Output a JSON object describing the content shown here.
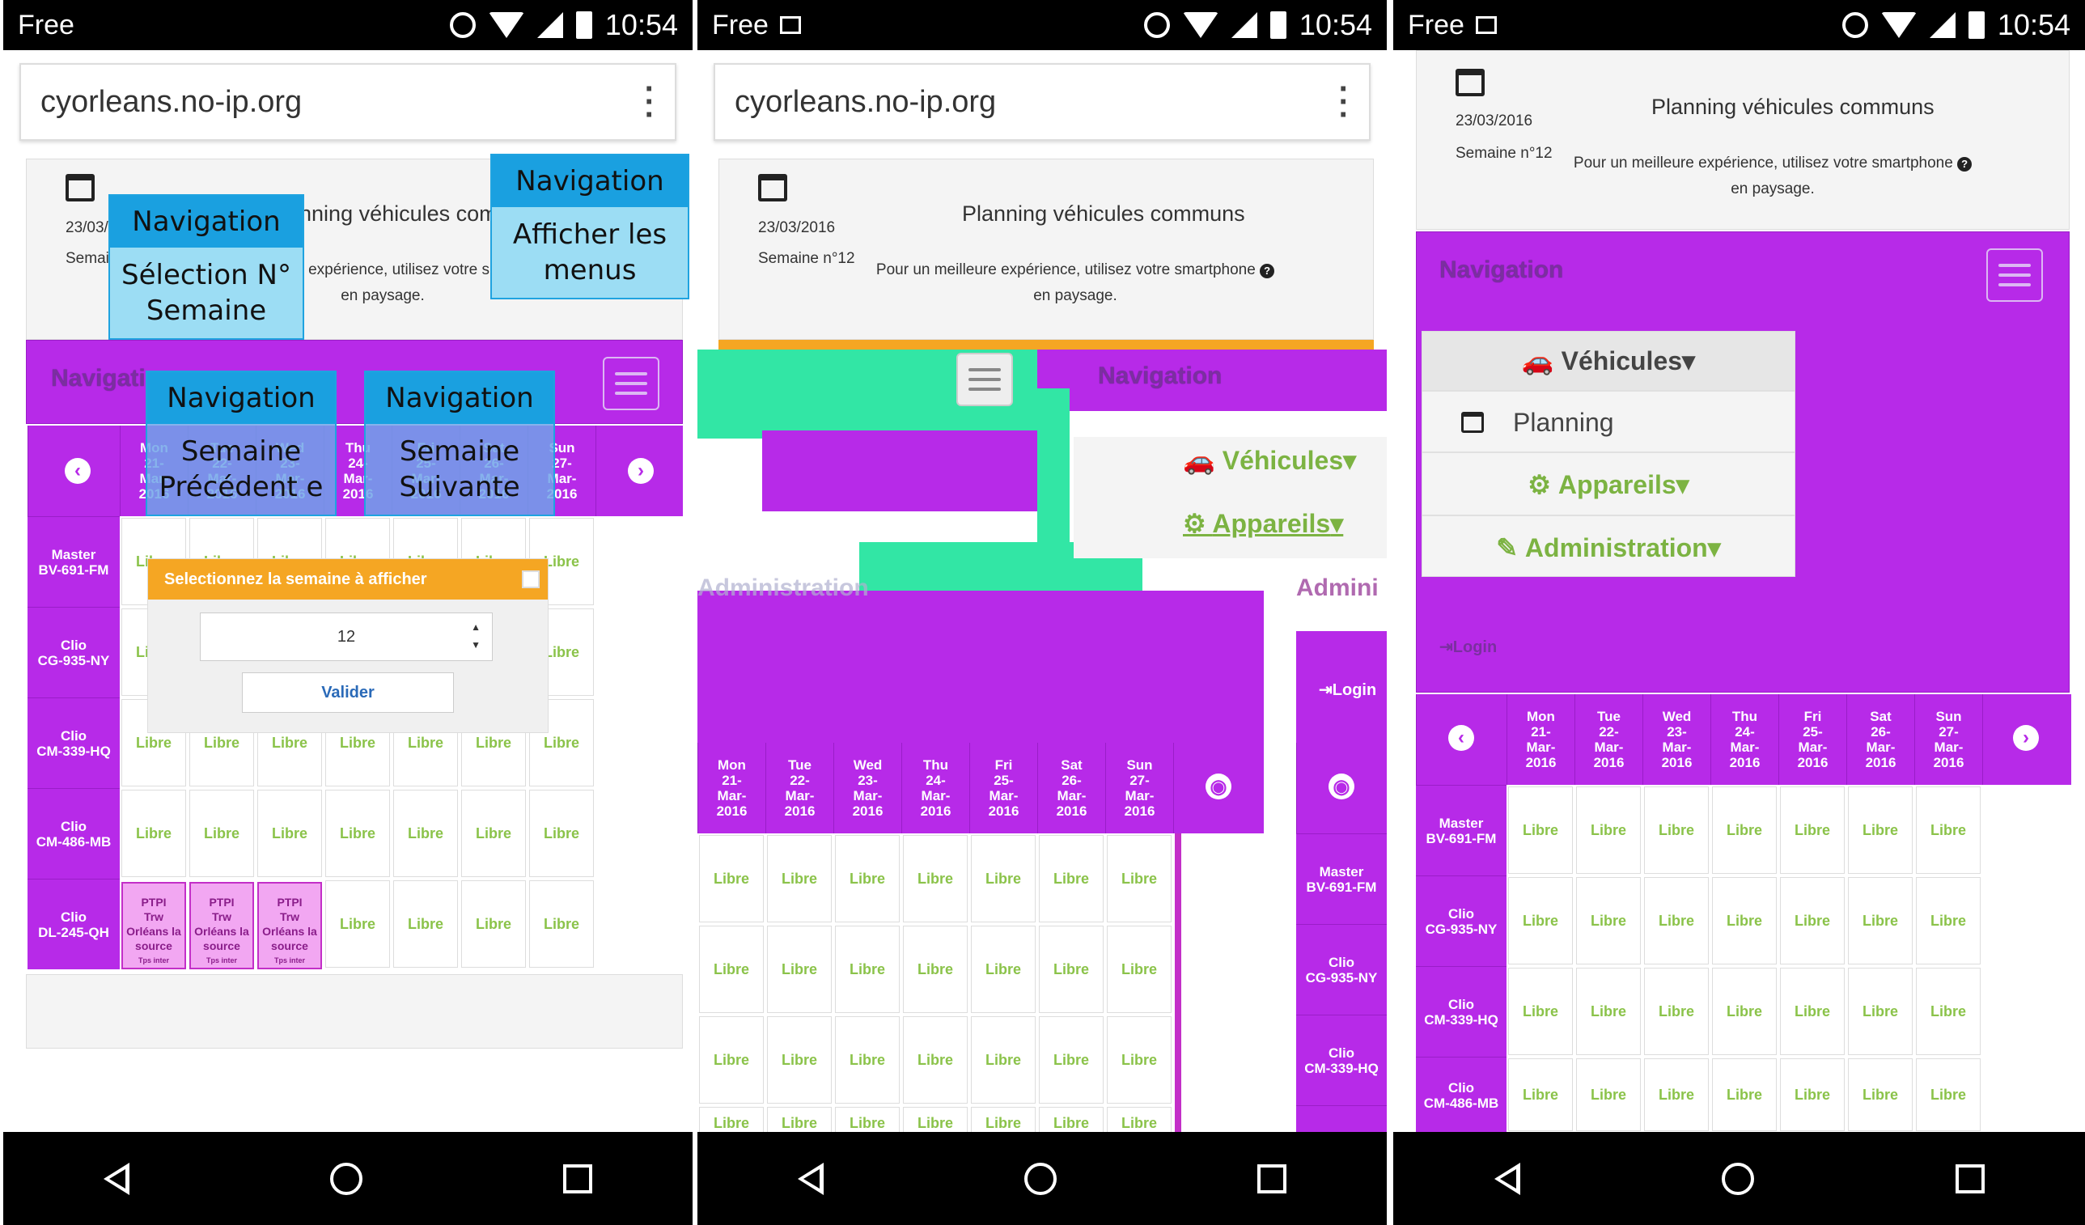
{
  "status": {
    "carrier": "Free",
    "time": "10:54"
  },
  "browser": {
    "url": "cyorleans.no-ip.org"
  },
  "header": {
    "date": "23/03/2016",
    "week": "Semaine n°12",
    "title": "Planning véhicules communs",
    "note_line1": "Pour un meilleure expérience, utilisez votre smartphone",
    "note_line2": "en paysage."
  },
  "nav": {
    "brand": "Navigation",
    "login": "Login"
  },
  "days": [
    {
      "d": "Mon",
      "n": "21-",
      "m": "Mar-",
      "y": "2016"
    },
    {
      "d": "Tue",
      "n": "22-",
      "m": "Mar-",
      "y": "2016"
    },
    {
      "d": "Wed",
      "n": "23-",
      "m": "Mar-",
      "y": "2016"
    },
    {
      "d": "Thu",
      "n": "24-",
      "m": "Mar-",
      "y": "2016"
    },
    {
      "d": "Fri",
      "n": "25-",
      "m": "Mar-",
      "y": "2016"
    },
    {
      "d": "Sat",
      "n": "26-",
      "m": "Mar-",
      "y": "2016"
    },
    {
      "d": "Sun",
      "n": "27-",
      "m": "Mar-",
      "y": "2016"
    }
  ],
  "vehicles": [
    {
      "model": "Master",
      "plate": "BV-691-FM"
    },
    {
      "model": "Clio",
      "plate": "CG-935-NY"
    },
    {
      "model": "Clio",
      "plate": "CM-339-HQ"
    },
    {
      "model": "Clio",
      "plate": "CM-486-MB"
    },
    {
      "model": "Clio",
      "plate": "DL-245-QH"
    }
  ],
  "cell_label": "Libre",
  "booking": {
    "l1": "PTPI",
    "l2": "Trw",
    "l3": "Orléans la",
    "l4": "source",
    "l5": "Tps inter"
  },
  "modal": {
    "title": "Selectionnez la semaine à afficher",
    "value": "12",
    "button": "Valider"
  },
  "menu": {
    "vehicules": "Véhicules",
    "planning": "Planning",
    "appareils": "Appareils",
    "administration": "Administration",
    "admin_short": "Admini"
  },
  "callouts": {
    "c1": {
      "top": "Navigation",
      "body": "Sélection N° Semaine"
    },
    "c2": {
      "top": "Navigation",
      "body": "Afficher les menus"
    },
    "c3": {
      "top": "Navigation",
      "body": "Semaine Précédent e"
    },
    "c4": {
      "top": "Navigation",
      "body": "Semaine Suivante"
    }
  },
  "colors": {
    "purple": "#b72ae8",
    "green": "#8bc34a",
    "orange": "#f5a623",
    "callout": "#5ac8f0"
  }
}
